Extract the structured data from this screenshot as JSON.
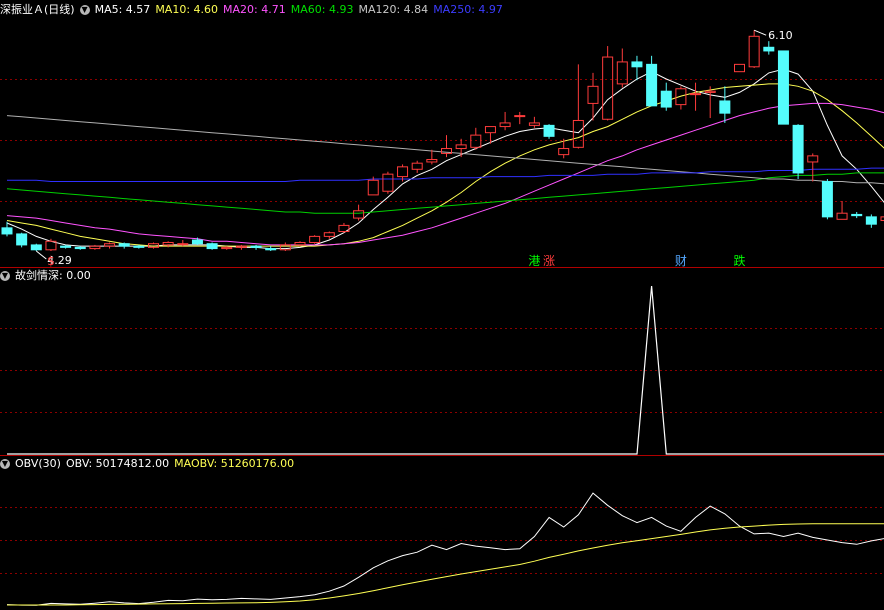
{
  "header": {
    "title": "深振业Ａ(日线)",
    "ma5": "MA5: 4.57",
    "ma10": "MA10: 4.60",
    "ma20": "MA20: 4.71",
    "ma60": "MA60: 4.93",
    "ma120": "MA120: 4.84",
    "ma250": "MA250: 4.97"
  },
  "indicator": {
    "title": "故剑情深",
    "value": ": 0.00"
  },
  "obv": {
    "title": "OBV(30)",
    "obv": "OBV: 50174812.00",
    "maobv": "MAOBV: 51260176.00"
  },
  "colors": {
    "up": "#ff3c3c",
    "down": "#54fcfc",
    "ma5": "#ffffff",
    "ma10": "#ffff54",
    "ma20": "#ff54ff",
    "ma60": "#00d000",
    "ma120": "#b0b0b0",
    "ma250": "#3030ff",
    "grid": "#8c0000",
    "frame": "#b00000"
  },
  "chart_data": [
    {
      "type": "candlestick",
      "panel": "price",
      "ylim": [
        4.2,
        6.2
      ],
      "annotations": {
        "high_label": "6.10",
        "low_label": "4.29"
      },
      "candles": [
        [
          4.48,
          4.43,
          4.53,
          4.41
        ],
        [
          4.43,
          4.34,
          4.44,
          4.32
        ],
        [
          4.34,
          4.3,
          4.35,
          4.29
        ],
        [
          4.3,
          4.37,
          4.39,
          4.29
        ],
        [
          4.33,
          4.32,
          4.34,
          4.31
        ],
        [
          4.32,
          4.31,
          4.33,
          4.3
        ],
        [
          4.31,
          4.33,
          4.34,
          4.3
        ],
        [
          4.33,
          4.35,
          4.36,
          4.31
        ],
        [
          4.35,
          4.33,
          4.36,
          4.31
        ],
        [
          4.33,
          4.32,
          4.34,
          4.31
        ],
        [
          4.32,
          4.35,
          4.36,
          4.31
        ],
        [
          4.34,
          4.36,
          4.37,
          4.32
        ],
        [
          4.35,
          4.35,
          4.38,
          4.33
        ],
        [
          4.38,
          4.35,
          4.4,
          4.34
        ],
        [
          4.35,
          4.31,
          4.36,
          4.3
        ],
        [
          4.31,
          4.32,
          4.33,
          4.3
        ],
        [
          4.32,
          4.33,
          4.34,
          4.3
        ],
        [
          4.33,
          4.32,
          4.34,
          4.3
        ],
        [
          4.31,
          4.3,
          4.33,
          4.29
        ],
        [
          4.3,
          4.34,
          4.36,
          4.29
        ],
        [
          4.34,
          4.36,
          4.37,
          4.33
        ],
        [
          4.36,
          4.41,
          4.42,
          4.35
        ],
        [
          4.41,
          4.44,
          4.45,
          4.39
        ],
        [
          4.45,
          4.5,
          4.52,
          4.44
        ],
        [
          4.56,
          4.62,
          4.67,
          4.54
        ],
        [
          4.75,
          4.87,
          4.9,
          4.75
        ],
        [
          4.78,
          4.92,
          4.94,
          4.76
        ],
        [
          4.9,
          4.98,
          5.0,
          4.86
        ],
        [
          4.96,
          5.01,
          5.03,
          4.93
        ],
        [
          5.02,
          5.04,
          5.12,
          5.0
        ],
        [
          5.09,
          5.13,
          5.24,
          5.06
        ],
        [
          5.13,
          5.16,
          5.21,
          5.06
        ],
        [
          5.14,
          5.24,
          5.3,
          5.12
        ],
        [
          5.26,
          5.31,
          5.31,
          5.17
        ],
        [
          5.31,
          5.34,
          5.43,
          5.28
        ],
        [
          5.4,
          5.4,
          5.43,
          5.33
        ],
        [
          5.32,
          5.34,
          5.39,
          5.3
        ],
        [
          5.32,
          5.23,
          5.33,
          5.21
        ],
        [
          5.08,
          5.13,
          5.21,
          5.05
        ],
        [
          5.14,
          5.36,
          5.82,
          5.13
        ],
        [
          5.5,
          5.64,
          5.75,
          5.36
        ],
        [
          5.37,
          5.88,
          5.97,
          5.36
        ],
        [
          5.66,
          5.84,
          5.95,
          5.63
        ],
        [
          5.84,
          5.8,
          5.89,
          5.69
        ],
        [
          5.82,
          5.48,
          5.89,
          5.48
        ],
        [
          5.6,
          5.47,
          5.67,
          5.44
        ],
        [
          5.49,
          5.62,
          5.64,
          5.45
        ],
        [
          5.58,
          5.58,
          5.67,
          5.44
        ],
        [
          5.59,
          5.6,
          5.64,
          5.38
        ],
        [
          5.52,
          5.42,
          5.64,
          5.34
        ],
        [
          5.76,
          5.82,
          5.82,
          5.76
        ],
        [
          5.8,
          6.05,
          6.1,
          5.79
        ],
        [
          5.96,
          5.93,
          6.01,
          5.9
        ],
        [
          5.93,
          5.33,
          5.93,
          5.33
        ],
        [
          5.32,
          4.93,
          5.33,
          4.88
        ],
        [
          5.02,
          5.07,
          5.09,
          4.86
        ],
        [
          4.86,
          4.57,
          4.88,
          4.55
        ],
        [
          4.55,
          4.6,
          4.7,
          4.55
        ],
        [
          4.59,
          4.58,
          4.61,
          4.56
        ],
        [
          4.57,
          4.51,
          4.59,
          4.48
        ],
        [
          4.54,
          4.57,
          4.61,
          4.52
        ],
        [
          4.55,
          4.57,
          4.61,
          4.52
        ]
      ],
      "ma": {
        "MA5": [
          4.52,
          4.47,
          4.41,
          4.37,
          4.34,
          4.33,
          4.33,
          4.33,
          4.33,
          4.33,
          4.33,
          4.34,
          4.34,
          4.34,
          4.34,
          4.33,
          4.32,
          4.32,
          4.31,
          4.31,
          4.32,
          4.34,
          4.38,
          4.44,
          4.52,
          4.63,
          4.73,
          4.84,
          4.91,
          4.96,
          5.03,
          5.08,
          5.13,
          5.18,
          5.23,
          5.27,
          5.29,
          5.3,
          5.28,
          5.26,
          5.38,
          5.53,
          5.62,
          5.7,
          5.76,
          5.7,
          5.65,
          5.6,
          5.57,
          5.55,
          5.59,
          5.66,
          5.75,
          5.78,
          5.74,
          5.6,
          5.32,
          5.07,
          4.96,
          4.82,
          4.67,
          4.57
        ],
        "MA10": [
          4.54,
          4.52,
          4.5,
          4.47,
          4.44,
          4.41,
          4.39,
          4.37,
          4.35,
          4.34,
          4.33,
          4.33,
          4.33,
          4.33,
          4.33,
          4.33,
          4.33,
          4.33,
          4.33,
          4.33,
          4.33,
          4.33,
          4.34,
          4.35,
          4.37,
          4.4,
          4.45,
          4.5,
          4.56,
          4.62,
          4.69,
          4.77,
          4.86,
          4.94,
          5.01,
          5.07,
          5.12,
          5.16,
          5.19,
          5.22,
          5.27,
          5.31,
          5.37,
          5.43,
          5.48,
          5.52,
          5.56,
          5.59,
          5.61,
          5.63,
          5.64,
          5.65,
          5.66,
          5.66,
          5.64,
          5.6,
          5.53,
          5.44,
          5.34,
          5.23,
          5.12,
          4.99
        ],
        "MA20": [
          4.58,
          4.57,
          4.56,
          4.54,
          4.52,
          4.5,
          4.48,
          4.47,
          4.45,
          4.43,
          4.42,
          4.41,
          4.4,
          4.39,
          4.37,
          4.37,
          4.36,
          4.35,
          4.34,
          4.34,
          4.34,
          4.34,
          4.34,
          4.35,
          4.36,
          4.38,
          4.4,
          4.42,
          4.45,
          4.48,
          4.52,
          4.56,
          4.6,
          4.64,
          4.68,
          4.73,
          4.78,
          4.83,
          4.88,
          4.93,
          4.98,
          5.03,
          5.07,
          5.12,
          5.16,
          5.2,
          5.24,
          5.28,
          5.32,
          5.36,
          5.4,
          5.43,
          5.46,
          5.48,
          5.49,
          5.5,
          5.5,
          5.49,
          5.47,
          5.45,
          5.42,
          5.39
        ],
        "MA60": [
          4.8,
          4.79,
          4.78,
          4.77,
          4.76,
          4.75,
          4.74,
          4.73,
          4.72,
          4.71,
          4.7,
          4.69,
          4.68,
          4.67,
          4.66,
          4.65,
          4.64,
          4.63,
          4.62,
          4.61,
          4.61,
          4.6,
          4.6,
          4.6,
          4.6,
          4.61,
          4.62,
          4.63,
          4.64,
          4.65,
          4.66,
          4.67,
          4.68,
          4.69,
          4.7,
          4.71,
          4.72,
          4.73,
          4.74,
          4.75,
          4.76,
          4.77,
          4.78,
          4.79,
          4.8,
          4.81,
          4.82,
          4.83,
          4.84,
          4.85,
          4.86,
          4.87,
          4.89,
          4.9,
          4.91,
          4.91,
          4.92,
          4.92,
          4.93,
          4.93,
          4.93,
          4.93
        ],
        "MA120": [
          5.4,
          5.39,
          5.38,
          5.37,
          5.36,
          5.35,
          5.34,
          5.33,
          5.32,
          5.31,
          5.3,
          5.29,
          5.28,
          5.27,
          5.26,
          5.25,
          5.24,
          5.23,
          5.22,
          5.21,
          5.2,
          5.19,
          5.18,
          5.17,
          5.16,
          5.15,
          5.14,
          5.13,
          5.12,
          5.11,
          5.1,
          5.09,
          5.08,
          5.07,
          5.06,
          5.05,
          5.04,
          5.03,
          5.02,
          5.01,
          5.0,
          4.99,
          4.98,
          4.97,
          4.96,
          4.95,
          4.94,
          4.93,
          4.92,
          4.91,
          4.9,
          4.89,
          4.88,
          4.88,
          4.87,
          4.87,
          4.86,
          4.86,
          4.85,
          4.85,
          4.84,
          4.84
        ],
        "MA250": [
          4.87,
          4.87,
          4.87,
          4.86,
          4.86,
          4.86,
          4.86,
          4.86,
          4.86,
          4.86,
          4.86,
          4.86,
          4.86,
          4.86,
          4.86,
          4.86,
          4.86,
          4.86,
          4.86,
          4.86,
          4.87,
          4.87,
          4.87,
          4.87,
          4.87,
          4.88,
          4.88,
          4.88,
          4.88,
          4.89,
          4.89,
          4.89,
          4.89,
          4.9,
          4.9,
          4.9,
          4.9,
          4.91,
          4.91,
          4.91,
          4.91,
          4.92,
          4.92,
          4.92,
          4.93,
          4.93,
          4.93,
          4.93,
          4.94,
          4.94,
          4.94,
          4.94,
          4.95,
          4.95,
          4.95,
          4.96,
          4.96,
          4.96,
          4.96,
          4.97,
          4.97,
          4.97
        ]
      },
      "markers": [
        {
          "index": 3,
          "text": "$",
          "color": "#ff3c3c"
        },
        {
          "index": 36,
          "text": "港",
          "color": "#00ff00"
        },
        {
          "index": 37,
          "text": "涨",
          "color": "#ff3c3c"
        },
        {
          "index": 46,
          "text": "财",
          "color": "#54a8ff"
        },
        {
          "index": 50,
          "text": "跌",
          "color": "#00ff00"
        }
      ]
    },
    {
      "type": "line",
      "panel": "indicator",
      "name": "故剑情深",
      "ylim": [
        0,
        1
      ],
      "values": [
        0,
        0,
        0,
        0,
        0,
        0,
        0,
        0,
        0,
        0,
        0,
        0,
        0,
        0,
        0,
        0,
        0,
        0,
        0,
        0,
        0,
        0,
        0,
        0,
        0,
        0,
        0,
        0,
        0,
        0,
        0,
        0,
        0,
        0,
        0,
        0,
        0,
        0,
        0,
        0,
        0,
        0,
        0,
        0,
        1,
        0,
        0,
        0,
        0,
        0,
        0,
        0,
        0,
        0,
        0,
        0,
        0,
        0,
        0,
        0,
        0,
        0
      ]
    },
    {
      "type": "line",
      "panel": "obv",
      "ylim": [
        4000000,
        80000000
      ],
      "series": [
        {
          "name": "OBV",
          "values": [
            4800000.0,
            4500000.0,
            4400000.0,
            5500000.0,
            5200000.0,
            5000000.0,
            5600000.0,
            6400000.0,
            5800000.0,
            5400000.0,
            6200000.0,
            7200000.0,
            7000000.0,
            8000000.0,
            7600000.0,
            7800000.0,
            8400000.0,
            8100000.0,
            7800000.0,
            8600000.0,
            9400000.0,
            10500000.0,
            12500000.0,
            15500000.0,
            20500000.0,
            26000000.0,
            30000000.0,
            33000000.0,
            35000000.0,
            39000000.0,
            36500000.0,
            40000000.0,
            38500000.0,
            37500000.0,
            36500000.0,
            37000000.0,
            44000000.0,
            55000000.0,
            49500000.0,
            56500000.0,
            69000000.0,
            62000000.0,
            56000000.0,
            52000000.0,
            55000000.0,
            50000000.0,
            47000000.0,
            55000000.0,
            61500000.0,
            57000000.0,
            50000000.0,
            45500000.0,
            46000000.0,
            44000000.0,
            46000000.0,
            43500000.0,
            42000000.0,
            40500000.0,
            39500000.0,
            41500000.0,
            43000000.0,
            42000000.0
          ]
        },
        {
          "name": "MAOBV",
          "values": [
            4600000.0,
            4600000.0,
            4600000.0,
            4600000.0,
            4600000.0,
            4700000.0,
            4800000.0,
            4900000.0,
            5000000.0,
            5100000.0,
            5200000.0,
            5300000.0,
            5400000.0,
            5500000.0,
            5600000.0,
            5700000.0,
            5800000.0,
            5900000.0,
            6100000.0,
            6400000.0,
            6900000.0,
            7600000.0,
            8600000.0,
            9800000.0,
            11200000.0,
            12800000.0,
            14500000.0,
            16200000.0,
            17800000.0,
            19400000.0,
            20900000.0,
            22400000.0,
            23800000.0,
            25200000.0,
            26500000.0,
            27900000.0,
            29800000.0,
            32000000.0,
            33800000.0,
            35700000.0,
            37400000.0,
            39000000.0,
            40400000.0,
            41600000.0,
            42800000.0,
            44000000.0,
            45200000.0,
            46600000.0,
            47800000.0,
            48800000.0,
            49500000.0,
            50000000.0,
            50600000.0,
            51000000.0,
            51200000.0,
            51300000.0,
            51300000.0,
            51300000.0,
            51300000.0,
            51300000.0,
            51300000.0,
            51300000.0
          ]
        }
      ]
    }
  ]
}
